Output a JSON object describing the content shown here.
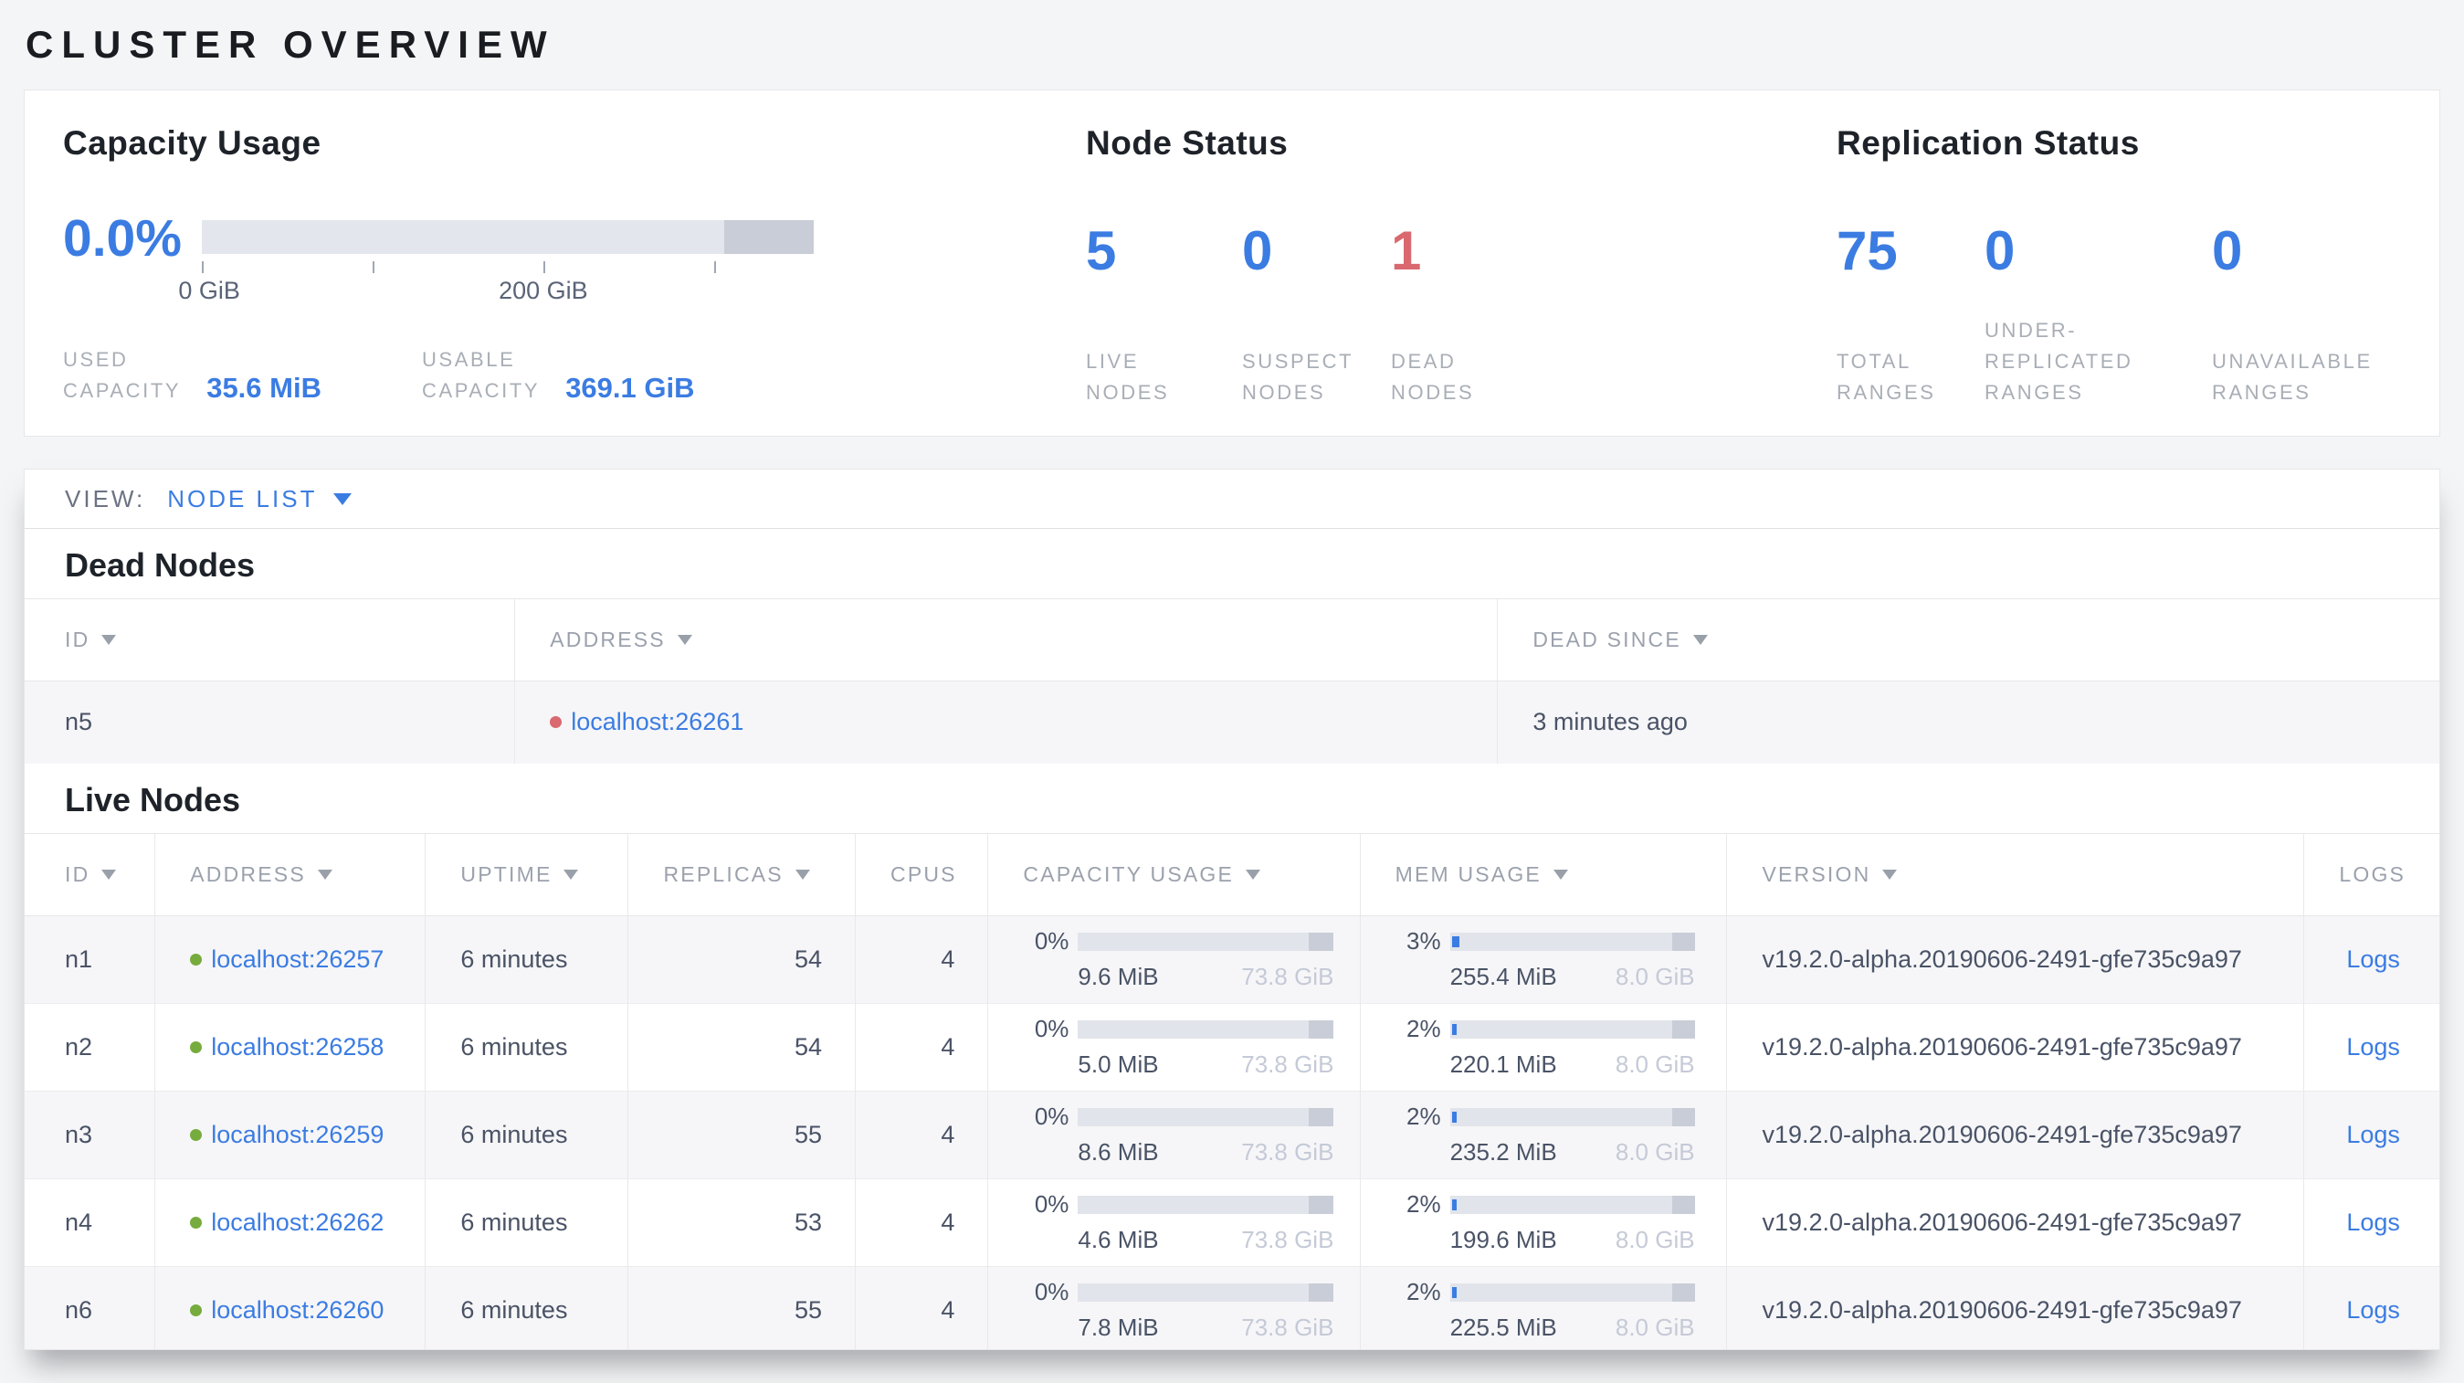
{
  "page_title": "CLUSTER OVERVIEW",
  "colors": {
    "accent_blue": "#3b7ce2",
    "danger_red": "#d9696e",
    "healthy_green": "#76ab3d"
  },
  "capacity_usage": {
    "heading": "Capacity Usage",
    "percent_used": "0.0%",
    "gauge_tick_labels": [
      "0 GiB",
      "200 GiB"
    ],
    "stats": [
      {
        "label": "USED\nCAPACITY",
        "value": "35.6 MiB"
      },
      {
        "label": "USABLE\nCAPACITY",
        "value": "369.1 GiB"
      }
    ]
  },
  "node_status": {
    "heading": "Node Status",
    "stats": [
      {
        "value": "5",
        "label": "LIVE\nNODES",
        "tone": "blue"
      },
      {
        "value": "0",
        "label": "SUSPECT\nNODES",
        "tone": "blue"
      },
      {
        "value": "1",
        "label": "DEAD\nNODES",
        "tone": "red"
      }
    ]
  },
  "replication_status": {
    "heading": "Replication Status",
    "stats": [
      {
        "value": "75",
        "label": "TOTAL\nRANGES",
        "tone": "blue"
      },
      {
        "value": "0",
        "label": "UNDER-\nREPLICATED\nRANGES",
        "tone": "blue"
      },
      {
        "value": "0",
        "label": "UNAVAILABLE\nRANGES",
        "tone": "blue"
      }
    ]
  },
  "view_bar": {
    "label": "VIEW:",
    "selected": "NODE LIST"
  },
  "dead_nodes": {
    "heading": "Dead Nodes",
    "columns": [
      {
        "label": "ID",
        "sortable": true
      },
      {
        "label": "ADDRESS",
        "sortable": true
      },
      {
        "label": "DEAD SINCE",
        "sortable": true
      }
    ],
    "rows": [
      {
        "id": "n5",
        "address": "localhost:26261",
        "dead_since": "3 minutes ago"
      }
    ]
  },
  "live_nodes": {
    "heading": "Live Nodes",
    "columns": [
      {
        "label": "ID",
        "sortable": true
      },
      {
        "label": "ADDRESS",
        "sortable": true
      },
      {
        "label": "UPTIME",
        "sortable": true
      },
      {
        "label": "REPLICAS",
        "sortable": true
      },
      {
        "label": "CPUS",
        "sortable": false
      },
      {
        "label": "CAPACITY USAGE",
        "sortable": true
      },
      {
        "label": "MEM USAGE",
        "sortable": true
      },
      {
        "label": "VERSION",
        "sortable": true
      },
      {
        "label": "LOGS",
        "sortable": false
      }
    ],
    "rows": [
      {
        "id": "n1",
        "address": "localhost:26257",
        "uptime": "6 minutes",
        "replicas": "54",
        "cpus": "4",
        "capacity": {
          "percent": "0%",
          "percent_value": 0,
          "used": "9.6 MiB",
          "total": "73.8 GiB"
        },
        "memory": {
          "percent": "3%",
          "percent_value": 3,
          "used": "255.4 MiB",
          "total": "8.0 GiB"
        },
        "version": "v19.2.0-alpha.20190606-2491-gfe735c9a97",
        "logs_label": "Logs"
      },
      {
        "id": "n2",
        "address": "localhost:26258",
        "uptime": "6 minutes",
        "replicas": "54",
        "cpus": "4",
        "capacity": {
          "percent": "0%",
          "percent_value": 0,
          "used": "5.0 MiB",
          "total": "73.8 GiB"
        },
        "memory": {
          "percent": "2%",
          "percent_value": 2,
          "used": "220.1 MiB",
          "total": "8.0 GiB"
        },
        "version": "v19.2.0-alpha.20190606-2491-gfe735c9a97",
        "logs_label": "Logs"
      },
      {
        "id": "n3",
        "address": "localhost:26259",
        "uptime": "6 minutes",
        "replicas": "55",
        "cpus": "4",
        "capacity": {
          "percent": "0%",
          "percent_value": 0,
          "used": "8.6 MiB",
          "total": "73.8 GiB"
        },
        "memory": {
          "percent": "2%",
          "percent_value": 2,
          "used": "235.2 MiB",
          "total": "8.0 GiB"
        },
        "version": "v19.2.0-alpha.20190606-2491-gfe735c9a97",
        "logs_label": "Logs"
      },
      {
        "id": "n4",
        "address": "localhost:26262",
        "uptime": "6 minutes",
        "replicas": "53",
        "cpus": "4",
        "capacity": {
          "percent": "0%",
          "percent_value": 0,
          "used": "4.6 MiB",
          "total": "73.8 GiB"
        },
        "memory": {
          "percent": "2%",
          "percent_value": 2,
          "used": "199.6 MiB",
          "total": "8.0 GiB"
        },
        "version": "v19.2.0-alpha.20190606-2491-gfe735c9a97",
        "logs_label": "Logs"
      },
      {
        "id": "n6",
        "address": "localhost:26260",
        "uptime": "6 minutes",
        "replicas": "55",
        "cpus": "4",
        "capacity": {
          "percent": "0%",
          "percent_value": 0,
          "used": "7.8 MiB",
          "total": "73.8 GiB"
        },
        "memory": {
          "percent": "2%",
          "percent_value": 2,
          "used": "225.5 MiB",
          "total": "8.0 GiB"
        },
        "version": "v19.2.0-alpha.20190606-2491-gfe735c9a97",
        "logs_label": "Logs"
      }
    ]
  }
}
